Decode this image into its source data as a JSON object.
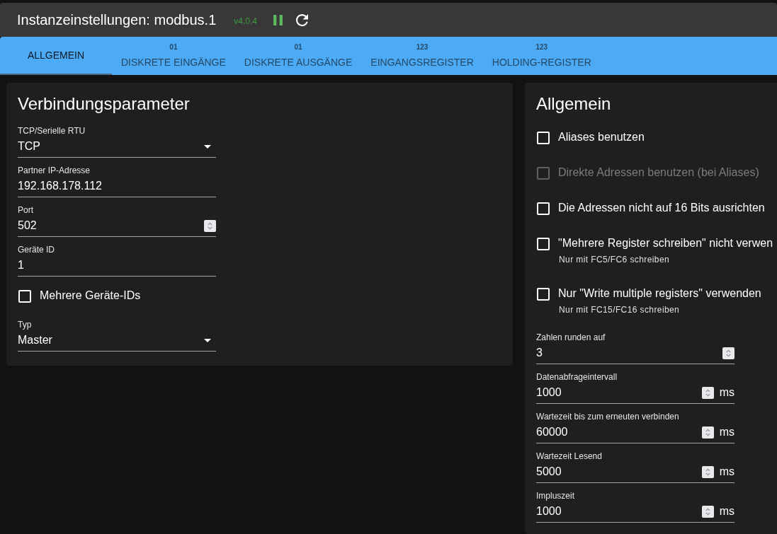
{
  "header": {
    "title": "Instanzeinstellungen: modbus.1",
    "version": "v4.0.4",
    "running": true
  },
  "tabs": [
    {
      "label": "ALLGEMEIN",
      "selected": true
    },
    {
      "icon_text": "01",
      "label": "DISKRETE EINGÄNGE",
      "selected": false
    },
    {
      "icon_text": "01",
      "label": "DISKRETE AUSGÄNGE",
      "selected": false
    },
    {
      "icon_text": "123",
      "label": "EINGANGSREGISTER",
      "selected": false
    },
    {
      "icon_text": "123",
      "label": "HOLDING-REGISTER",
      "selected": false
    }
  ],
  "sections": [
    {
      "title": "Verbindungsparameter",
      "fields": [
        {
          "kind": "select",
          "label": "TCP/Serielle RTU",
          "value": "TCP"
        },
        {
          "kind": "text",
          "label": "Partner IP-Adresse",
          "value": "192.168.178.112"
        },
        {
          "kind": "number",
          "label": "Port",
          "value": "502"
        },
        {
          "kind": "text",
          "label": "Geräte ID",
          "value": "1"
        },
        {
          "kind": "checkbox",
          "label": "Mehrere Geräte-IDs",
          "checked": false,
          "disabled": false
        },
        {
          "kind": "select",
          "label": "Typ",
          "value": "Master"
        }
      ]
    },
    {
      "title": "Allgemein",
      "fields": [
        {
          "kind": "checkbox",
          "label": "Aliases benutzen",
          "checked": false,
          "disabled": false
        },
        {
          "kind": "checkbox",
          "label": "Direkte Adressen benutzen (bei Aliases)",
          "checked": false,
          "disabled": true
        },
        {
          "kind": "checkbox",
          "label": "Die Adressen nicht auf 16 Bits ausrichten",
          "checked": false,
          "disabled": false
        },
        {
          "kind": "checkbox",
          "label": "\"Mehrere Register schreiben\" nicht verwen",
          "hint": "Nur mit FC5/FC6 schreiben",
          "checked": false,
          "disabled": false
        },
        {
          "kind": "checkbox",
          "label": "Nur \"Write multiple registers\" verwenden",
          "hint": "Nur mit FC15/FC16 schreiben",
          "checked": false,
          "disabled": false
        },
        {
          "kind": "number",
          "label": "Zahlen runden auf",
          "value": "3"
        },
        {
          "kind": "number",
          "label": "Datenabfrageintervall",
          "value": "1000",
          "unit": "ms"
        },
        {
          "kind": "number",
          "label": "Wartezeit bis zum erneuten verbinden",
          "value": "60000",
          "unit": "ms"
        },
        {
          "kind": "number",
          "label": "Wartezeit Lesend",
          "value": "5000",
          "unit": "ms"
        },
        {
          "kind": "number",
          "label": "Impluszeit",
          "value": "1000",
          "unit": "ms"
        }
      ]
    }
  ]
}
